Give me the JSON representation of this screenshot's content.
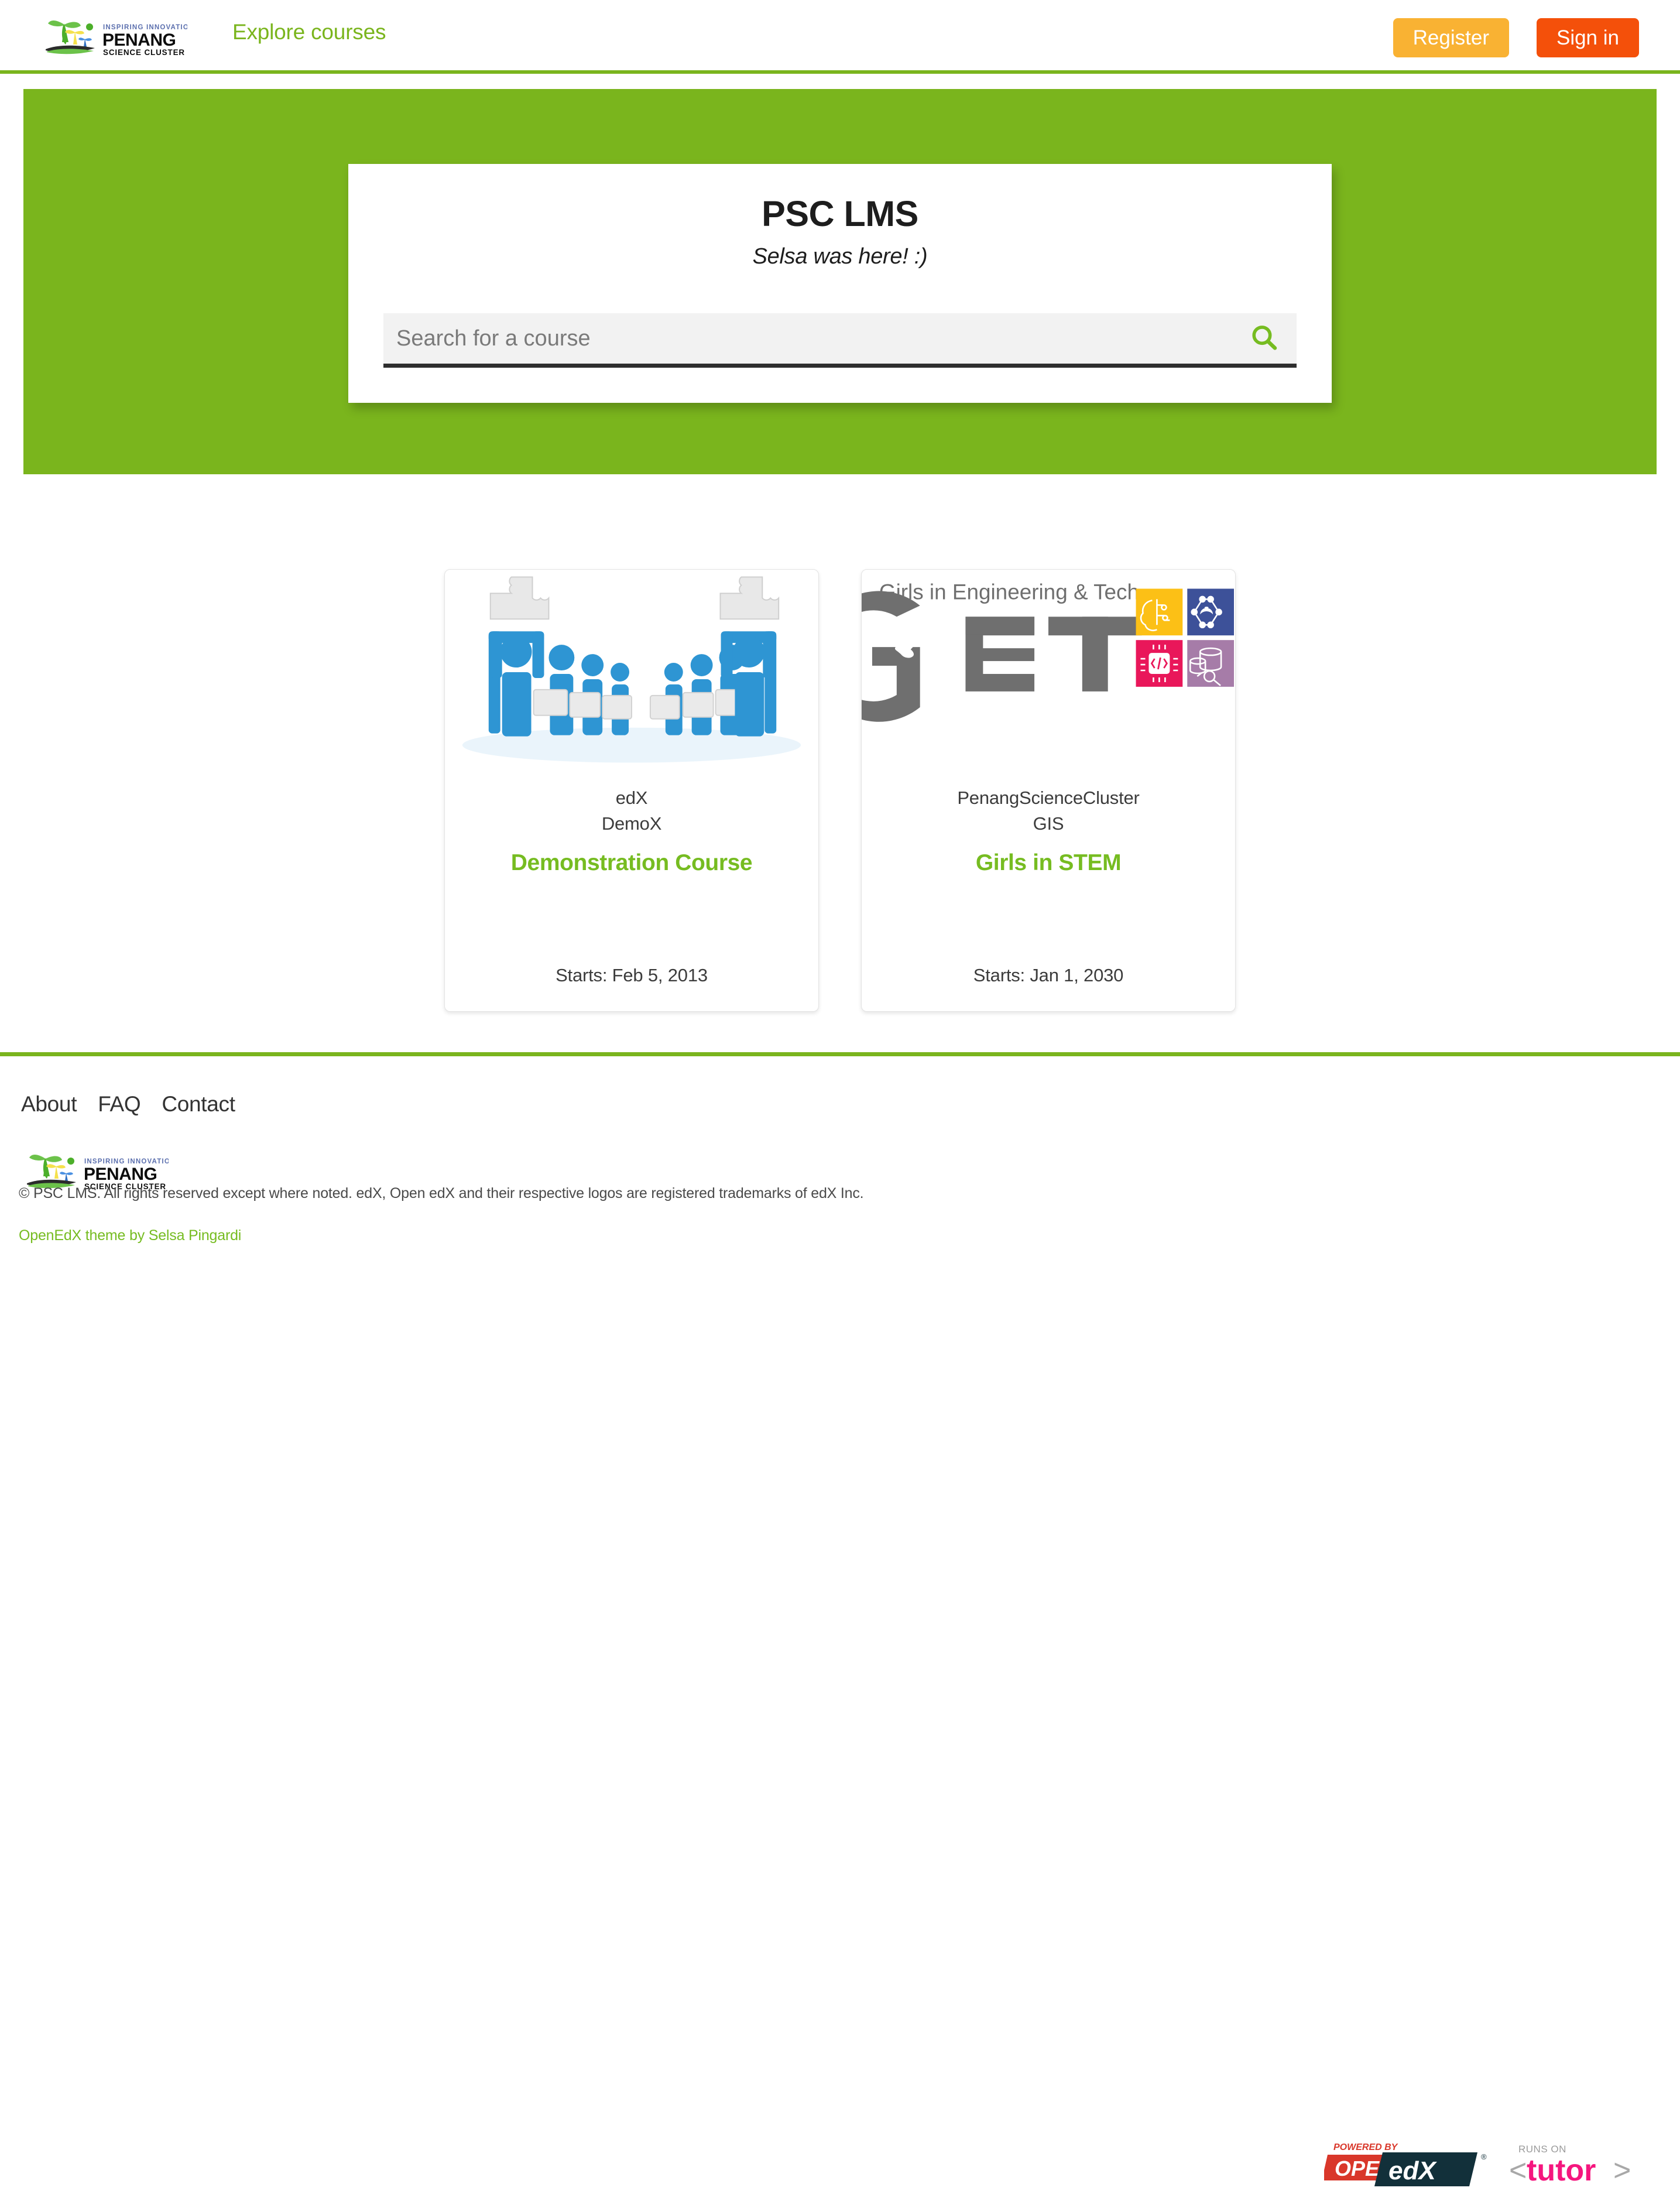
{
  "header": {
    "logo_alt": "Penang Science Cluster — Inspiring Innovation",
    "logo_tagline": "INSPIRING INNOVATION",
    "logo_name": "PENANG",
    "logo_sub": "SCIENCE CLUSTER",
    "explore_label": "Explore courses",
    "register_label": "Register",
    "signin_label": "Sign in"
  },
  "hero": {
    "title": "PSC LMS",
    "subtitle": "Selsa was here! :)",
    "search_placeholder": "Search for a course",
    "search_value": "",
    "background_color": "#7ab51d"
  },
  "courses": [
    {
      "org": "edX",
      "number": "DemoX",
      "title": "Demonstration Course",
      "start": "Starts: Feb 5, 2013",
      "thumb": "puzzle-people-illustration"
    },
    {
      "org": "PenangScienceCluster",
      "number": "GIS",
      "title": "Girls in STEM",
      "start": "Starts: Jan 1, 2030",
      "thumb": "get-girls-in-engineering-and-tech-logo",
      "thumb_text": {
        "tagline": "Girls in Engineering & Tech",
        "wordmark": "GET"
      }
    }
  ],
  "footer": {
    "links": [
      "About",
      "FAQ",
      "Contact"
    ],
    "logo_alt": "Penang Science Cluster",
    "copyright": "© PSC LMS. All rights reserved except where noted. edX, Open edX and their respective logos are registered trademarks of edX Inc.",
    "theme_credit": "OpenEdX theme by Selsa Pingardi",
    "badges": {
      "openedx": {
        "powered_by": "POWERED BY",
        "open": "OPEN",
        "edx": "edX",
        "registered": "®"
      },
      "tutor": {
        "runs_on": "RUNS ON",
        "name": "tutor",
        "bracket_left": "<",
        "bracket_right": ">"
      }
    }
  },
  "colors": {
    "brand_green": "#7ab51d",
    "link_green": "#76bc21",
    "register_orange": "#f9b233",
    "signin_orange": "#f4500a",
    "tutor_pink": "#f5167e",
    "openedx_red": "#d9372a",
    "openedx_dark": "#12303a"
  }
}
